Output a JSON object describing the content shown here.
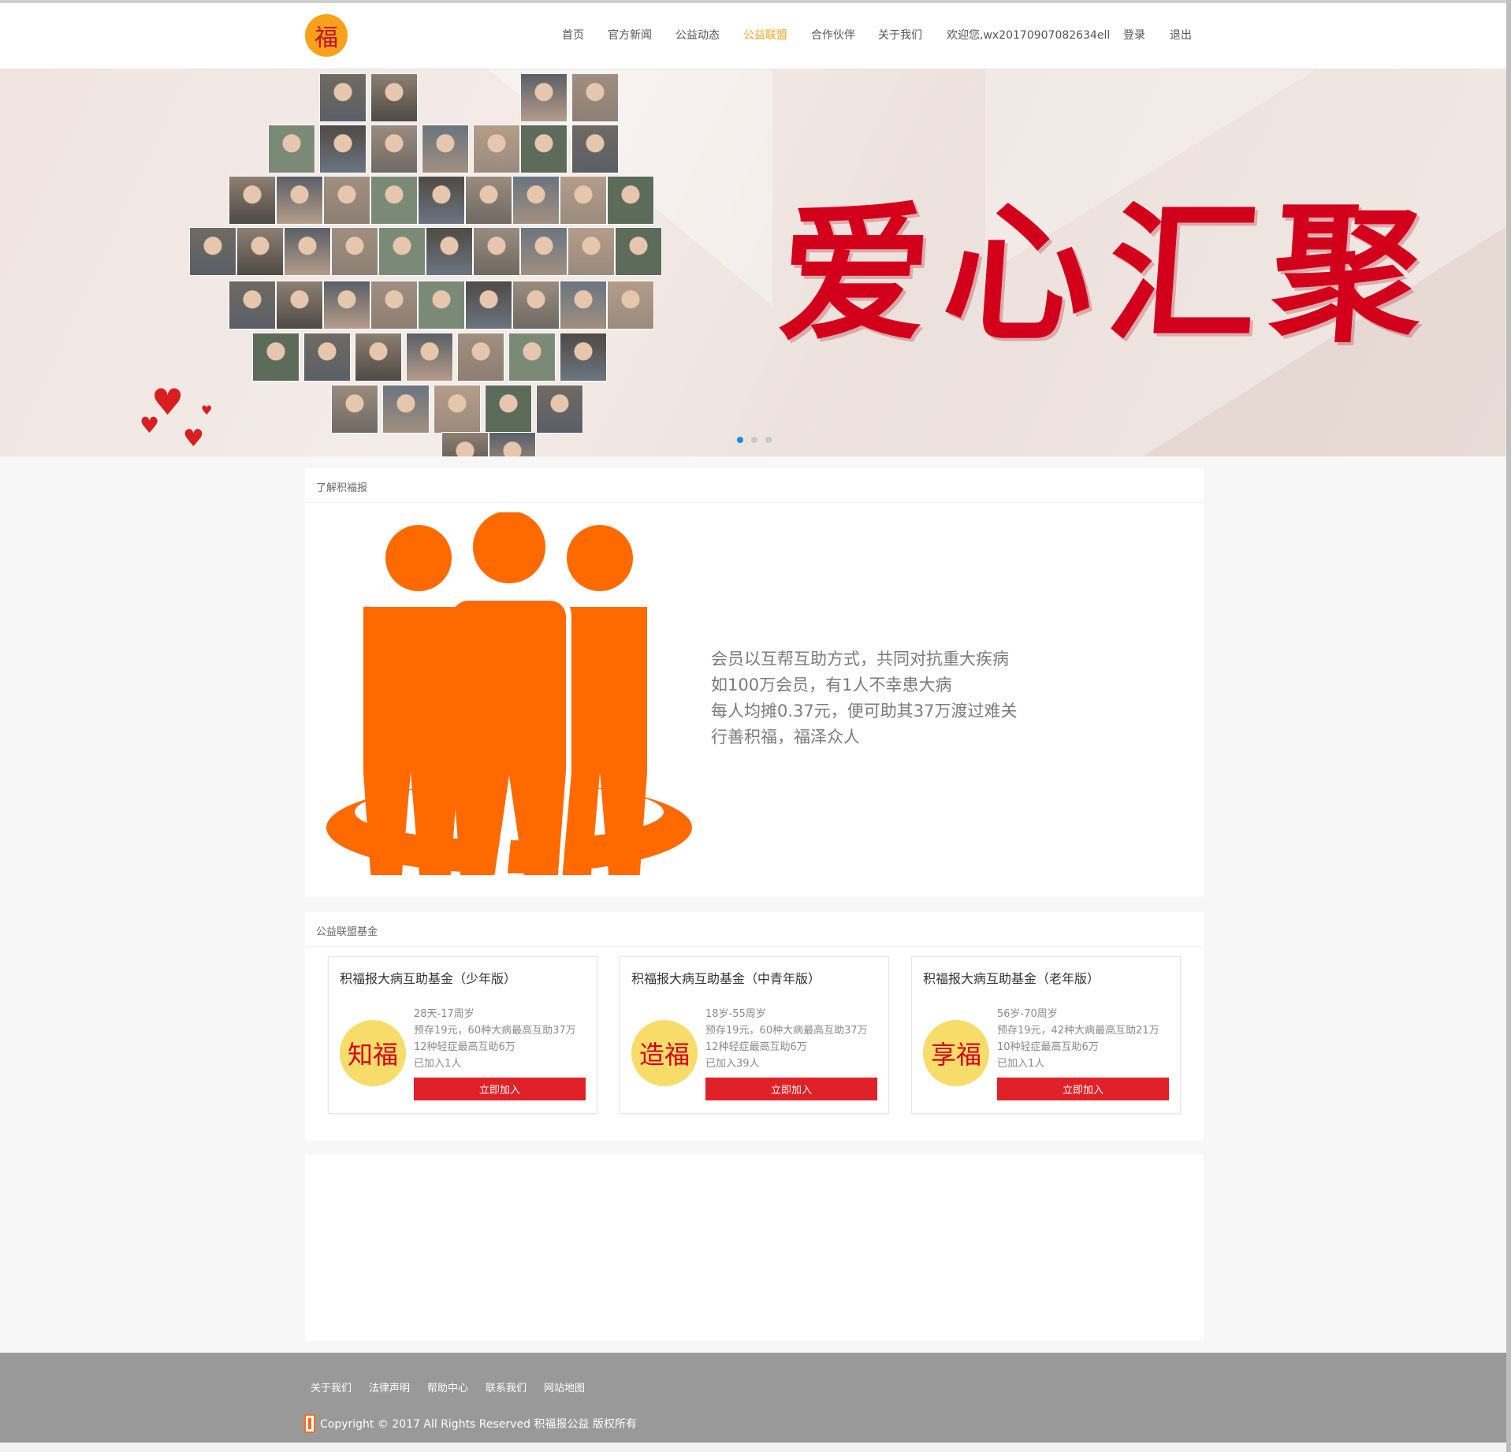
{
  "brand": {
    "logo_char": "福",
    "logo_color": "#f7a21a"
  },
  "nav": {
    "items": [
      {
        "label": "首页"
      },
      {
        "label": "官方新闻"
      },
      {
        "label": "公益动态"
      },
      {
        "label": "公益联盟",
        "active": true
      },
      {
        "label": "合作伙伴"
      },
      {
        "label": "关于我们"
      },
      {
        "label": "欢迎您,wx20170907082634ell"
      },
      {
        "label": "登录"
      },
      {
        "label": "退出"
      }
    ],
    "active_color": "#f5a623"
  },
  "banner": {
    "headline": "爱心汇聚",
    "carousel_active": 1,
    "carousel_count": 3
  },
  "about": {
    "section_title": "了解积福报",
    "lines": [
      "会员以互帮互助方式，共同对抗重大疾病",
      "如100万会员，有1人不幸患大病",
      "每人均摊0.37元，便可助其37万渡过难关",
      "行善积福，福泽众人"
    ],
    "icon": "people-group-icon",
    "icon_color": "#ff6a00"
  },
  "funds": {
    "section_title": "公益联盟基金",
    "cards": [
      {
        "title": "积福报大病互助基金（少年版）",
        "badge": "知福",
        "age": "28天-17周岁",
        "coverage": "预存19元，60种大病最高互助37万",
        "minor": "12种轻症最高互助6万",
        "joined": "已加入1人",
        "button": "立即加入"
      },
      {
        "title": "积福报大病互助基金（中青年版）",
        "badge": "造福",
        "age": "18岁-55周岁",
        "coverage": "预存19元，60种大病最高互助37万",
        "minor": "12种轻症最高互助6万",
        "joined": "已加入39人",
        "button": "立即加入"
      },
      {
        "title": "积福报大病互助基金（老年版）",
        "badge": "享福",
        "age": "56岁-70周岁",
        "coverage": "预存19元，42种大病最高互助21万",
        "minor": "10种轻症最高互助6万",
        "joined": "已加入1人",
        "button": "立即加入"
      }
    ],
    "button_color": "#e02127"
  },
  "footer": {
    "links": [
      "关于我们",
      "法律声明",
      "帮助中心",
      "联系我们",
      "网站地图"
    ],
    "copyright": "Copyright © 2017 All Rights Reserved 积福报公益 版权所有"
  }
}
